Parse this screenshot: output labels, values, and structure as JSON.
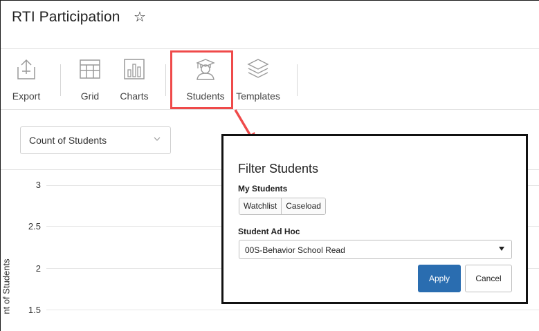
{
  "page": {
    "title": "RTI Participation"
  },
  "toolbar": {
    "buttons": [
      {
        "label": "Export",
        "icon": "export-icon"
      },
      {
        "label": "Grid",
        "icon": "grid-icon"
      },
      {
        "label": "Charts",
        "icon": "charts-icon"
      },
      {
        "label": "Students",
        "icon": "students-icon"
      },
      {
        "label": "Templates",
        "icon": "templates-icon"
      }
    ]
  },
  "measure_select": {
    "value": "Count of Students"
  },
  "chart": {
    "y_ticks": [
      "3",
      "2.5",
      "2",
      "1.5"
    ],
    "y_label": "nt of Students"
  },
  "filter_popup": {
    "title": "Filter Students",
    "my_students_label": "My Students",
    "watchlist_label": "Watchlist",
    "caseload_label": "Caseload",
    "ad_hoc_label": "Student Ad Hoc",
    "ad_hoc_value": "00S-Behavior School Read",
    "apply_label": "Apply",
    "cancel_label": "Cancel"
  },
  "colors": {
    "accent": "#2a6db0",
    "callout": "#ef4a4a"
  }
}
